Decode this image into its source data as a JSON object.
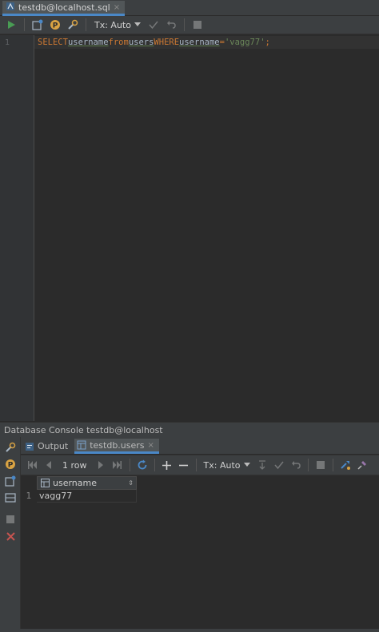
{
  "editor_tab": {
    "label": "testdb@localhost.sql",
    "close": "×"
  },
  "toolbar": {
    "tx_label": "Tx: Auto"
  },
  "editor": {
    "line_number": "1",
    "query": {
      "select": "SELECT",
      "col": "username",
      "from": "from",
      "table": "users",
      "where": "WHERE",
      "cond_col": "username",
      "eq": "=",
      "value": "'vagg77'",
      "semi": ";"
    }
  },
  "panel": {
    "title": "Database Console testdb@localhost",
    "tabs": [
      {
        "label": "Output"
      },
      {
        "label": "testdb.users",
        "close": "×"
      }
    ]
  },
  "results_toolbar": {
    "row_count": "1 row",
    "tx_label": "Tx: Auto"
  },
  "grid": {
    "columns": [
      "username"
    ],
    "rows": [
      {
        "num": "1",
        "cells": [
          "vagg77"
        ]
      }
    ]
  },
  "colors": {
    "accent": "#4a88c7",
    "run_green": "#499c54",
    "error_red": "#c75450",
    "keyword": "#cc7832",
    "string": "#6a8759"
  }
}
